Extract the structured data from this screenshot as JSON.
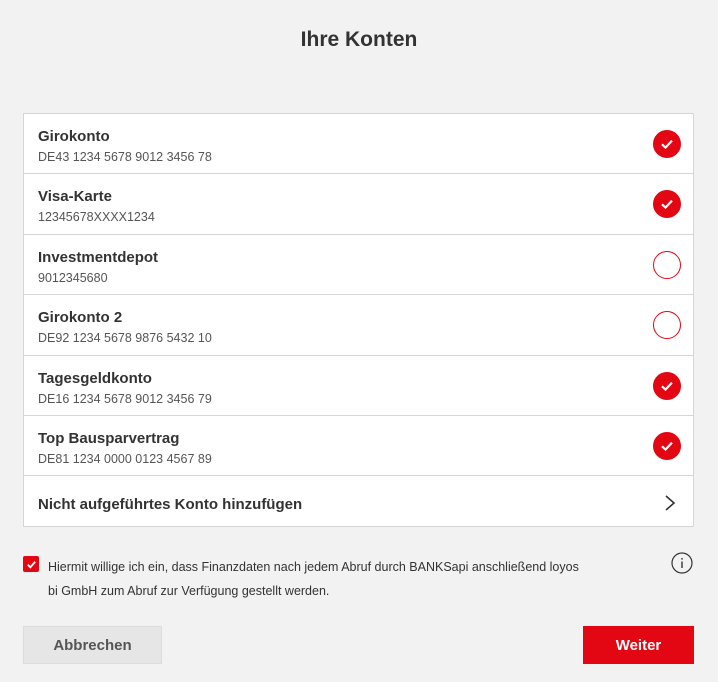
{
  "dialog": {
    "title": "Ihre Konten"
  },
  "accounts": [
    {
      "name": "Girokonto",
      "iban": "DE43 1234 5678 9012 3456 78",
      "selected": true
    },
    {
      "name": "Visa-Karte",
      "iban": "12345678XXXX1234",
      "selected": true
    },
    {
      "name": "Investmentdepot",
      "iban": "9012345680",
      "selected": false
    },
    {
      "name": "Girokonto 2",
      "iban": "DE92 1234 5678 9876 5432 10",
      "selected": false
    },
    {
      "name": "Tagesgeldkonto",
      "iban": "DE16 1234 5678 9012 3456 79",
      "selected": true
    },
    {
      "name": "Top Bausparvertrag",
      "iban": "DE81 1234 0000 0123 4567 89",
      "selected": true
    }
  ],
  "add_account": {
    "label": "Nicht aufgeführtes Konto hinzufügen",
    "icon": "chevron-right-icon"
  },
  "consent": {
    "checked": true,
    "text": "Hiermit willige ich ein, dass Finanzdaten nach jedem Abruf durch BANKSapi anschließend loyos bi GmbH zum Abruf zur Verfügung gestellt werden.",
    "info_icon": "info-icon"
  },
  "buttons": {
    "cancel_label": "Abbrechen",
    "next_label": "Weiter"
  },
  "colors": {
    "accent": "#e30613",
    "background": "#f2f2f2",
    "card": "#ffffff",
    "text": "#333333",
    "secondary_button": "#e6e6e6"
  }
}
